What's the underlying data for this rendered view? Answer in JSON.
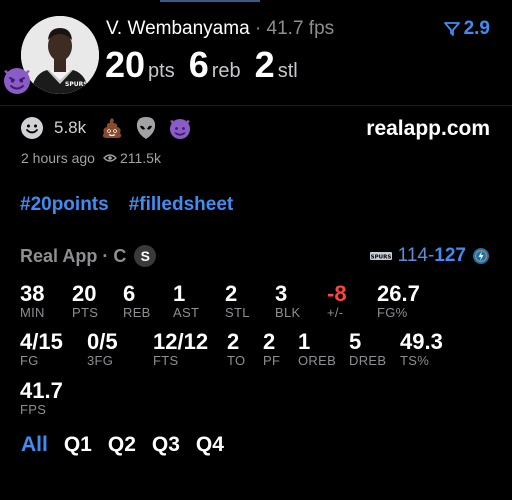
{
  "header": {
    "player_name": "V. Wembanyama",
    "separator": " · ",
    "fps": "41.7 fps",
    "rating": "2.9",
    "headline_stats": [
      {
        "value": "20",
        "label": "pts"
      },
      {
        "value": "6",
        "label": "reb"
      },
      {
        "value": "2",
        "label": "stl"
      }
    ],
    "jersey_text": "SPURS",
    "colors": {
      "accent": "#3d8df5",
      "negative": "#ff453a"
    }
  },
  "reactions": {
    "smile_count": "5.8k",
    "icons": [
      "smile-emoji-icon",
      "poop-emoji-icon",
      "alien-emoji-icon",
      "devil-emoji-icon"
    ]
  },
  "site": "realapp.com",
  "meta": {
    "time": "2 hours ago",
    "views": "211.5k"
  },
  "hashtags": [
    "#20points",
    "#filledsheet"
  ],
  "game": {
    "title": "Real App · C",
    "badge": "S",
    "score_home": "114",
    "score_dash": "-",
    "score_away": "127"
  },
  "stats": {
    "row1": [
      {
        "value": "38",
        "label": "MIN"
      },
      {
        "value": "20",
        "label": "PTS"
      },
      {
        "value": "6",
        "label": "REB"
      },
      {
        "value": "1",
        "label": "AST"
      },
      {
        "value": "2",
        "label": "STL"
      },
      {
        "value": "3",
        "label": "BLK"
      },
      {
        "value": "-8",
        "label": "+/-"
      },
      {
        "value": "26.7",
        "label": "FG%"
      }
    ],
    "row2": [
      {
        "value": "4/15",
        "label": "FG"
      },
      {
        "value": "0/5",
        "label": "3FG"
      },
      {
        "value": "12/12",
        "label": "FTS"
      },
      {
        "value": "2",
        "label": "TO"
      },
      {
        "value": "2",
        "label": "PF"
      },
      {
        "value": "1",
        "label": "OREB"
      },
      {
        "value": "5",
        "label": "DREB"
      },
      {
        "value": "49.3",
        "label": "TS%"
      }
    ],
    "row3": [
      {
        "value": "41.7",
        "label": "FPS"
      }
    ]
  },
  "tabs": [
    "All",
    "Q1",
    "Q2",
    "Q3",
    "Q4"
  ]
}
